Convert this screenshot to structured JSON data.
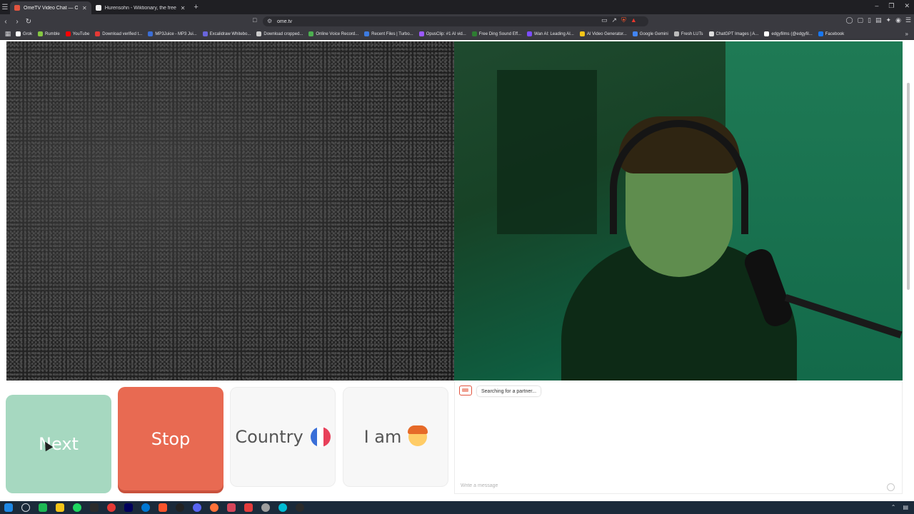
{
  "browser": {
    "tabs": [
      {
        "title": "OmeTV Video Chat — Omeg",
        "active": true,
        "favicon_color": "#e2543f"
      },
      {
        "title": "Hurensohn - Wiktionary, the free dict",
        "active": false,
        "favicon_color": "#f2f2f2"
      }
    ],
    "url": "ome.tv",
    "bookmarks": [
      {
        "label": "Grok",
        "color": "#ffffff"
      },
      {
        "label": "Rumble",
        "color": "#85c742"
      },
      {
        "label": "YouTube",
        "color": "#ff0000"
      },
      {
        "label": "Download verified t...",
        "color": "#e53935"
      },
      {
        "label": "MP3Juice - MP3 Jui...",
        "color": "#3b6ed6"
      },
      {
        "label": "Excalidraw Whitebo...",
        "color": "#6965db"
      },
      {
        "label": "Download cropped...",
        "color": "#cccccc"
      },
      {
        "label": "Online Voice Record...",
        "color": "#4caf50"
      },
      {
        "label": "Recent Files | Turbo...",
        "color": "#3d7be0"
      },
      {
        "label": "OpusClip: #1 AI vid...",
        "color": "#9b59ff"
      },
      {
        "label": "Free Ding Sound Eff...",
        "color": "#2e7d32"
      },
      {
        "label": "Wan AI: Leading AI...",
        "color": "#7c4dff"
      },
      {
        "label": "AI Video Generator...",
        "color": "#f5c518"
      },
      {
        "label": "Google Gemini",
        "color": "#4285f4"
      },
      {
        "label": "Fresh LUTs",
        "color": "#bbbbbb"
      },
      {
        "label": "ChatGPT Images | A...",
        "color": "#dddddd"
      },
      {
        "label": "edgyfilms (@edgyfil...",
        "color": "#ffffff"
      },
      {
        "label": "Facebook",
        "color": "#1877f2"
      }
    ]
  },
  "controls": {
    "next_label": "Next",
    "stop_label": "Stop",
    "country_label": "Country",
    "iam_label": "I am"
  },
  "chat": {
    "status_message": "Searching for a partner...",
    "input_placeholder": "Write a message"
  },
  "taskbar": {
    "app_colors": [
      "#1e88e5",
      "#7c8a99",
      "#1db954",
      "#2b6fbd",
      "#f5c518",
      "#1ed760",
      "#e53935",
      "#00005b",
      "#0078d4",
      "#fb542b",
      "#4caf50",
      "#5865f2",
      "#ff7139",
      "#d6455a",
      "#e43c3c",
      "#9e9e9e",
      "#00bcd4",
      "#ffffff"
    ]
  }
}
